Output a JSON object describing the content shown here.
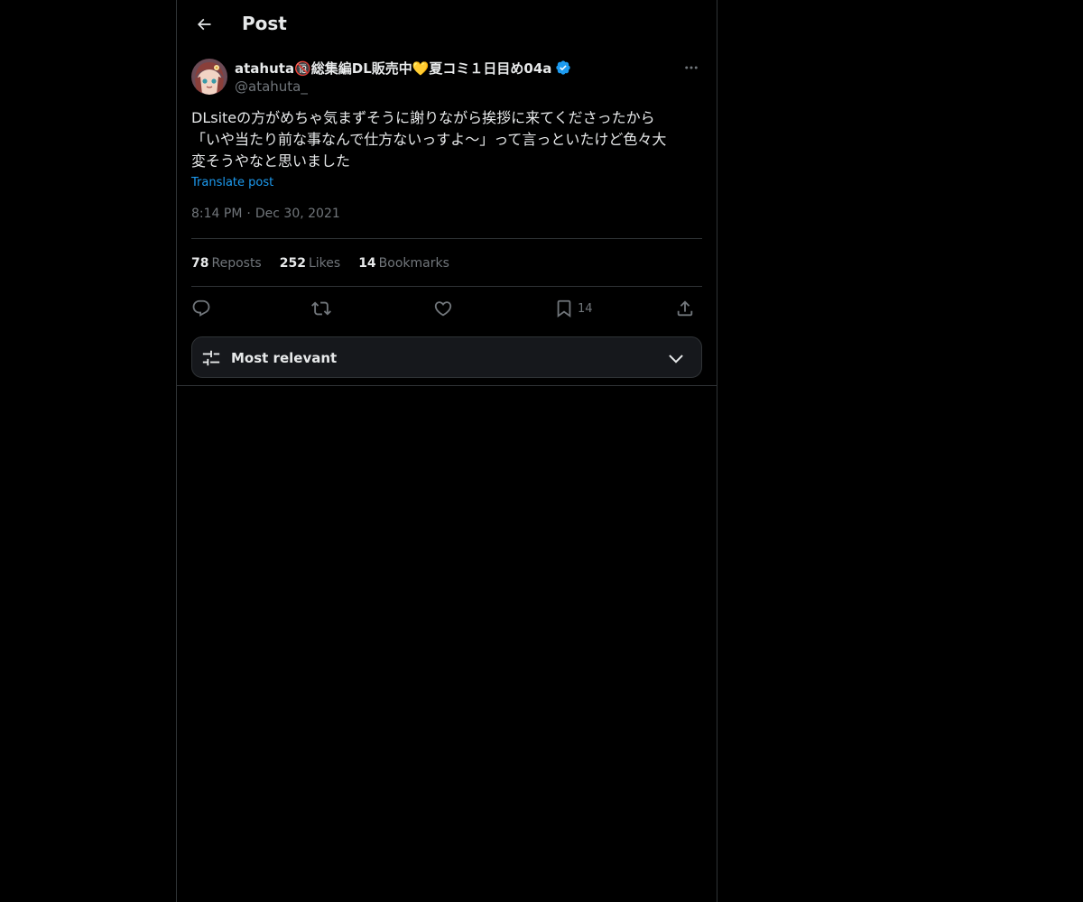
{
  "header": {
    "title": "Post",
    "back_icon": "arrow-left-icon"
  },
  "author": {
    "display_name": "atahuta🔞総集編DL販売中💛夏コミ１日目め04a",
    "handle": "@atahuta_",
    "verified": true
  },
  "tweet": {
    "text_lines": [
      "DLsiteの方がめちゃ気まずそうに謝りながら挨拶に来てくださったから",
      "「いや当たり前な事なんで仕方ないっすよ〜」って言っといたけど色々大",
      "変そうやなと思いました"
    ],
    "translate_label": "Translate post",
    "time": "8:14 PM",
    "separator": "·",
    "date": "Dec 30, 2021"
  },
  "stats": {
    "reposts": {
      "count": "78",
      "label": "Reposts"
    },
    "likes": {
      "count": "252",
      "label": "Likes"
    },
    "bookmarks": {
      "count": "14",
      "label": "Bookmarks"
    }
  },
  "actions": {
    "bookmark_count": "14"
  },
  "sort": {
    "label": "Most relevant"
  },
  "colors": {
    "background": "#000000",
    "text": "#e7e9ea",
    "muted": "#71767b",
    "accent": "#1d9bf0",
    "border": "#2f3336"
  }
}
